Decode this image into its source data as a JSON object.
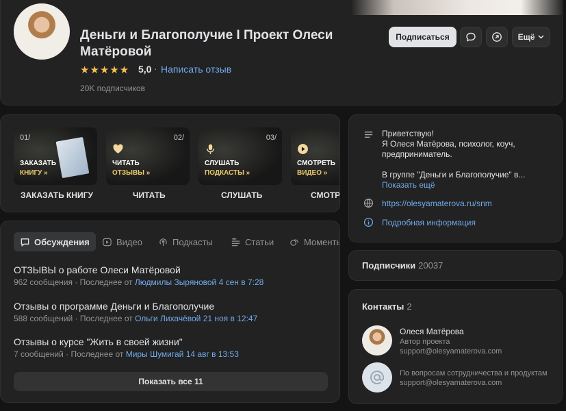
{
  "header": {
    "title": "Деньги и Благополучие I Проект Олеси Матёровой",
    "stars": "★★★★★",
    "rating": "5,0",
    "separator": "·",
    "write_review": "Написать отзыв",
    "subscribers": "20K подписчиков",
    "subscribe": "Подписаться",
    "more": "Ещё"
  },
  "tiles": [
    {
      "num": "01/",
      "line1": "ЗАКАЗАТЬ",
      "line2": "КНИГУ »",
      "label": "ЗАКАЗАТЬ КНИГУ"
    },
    {
      "num": "02/",
      "line1": "ЧИТАТЬ",
      "line2": "ОТЗЫВЫ »",
      "label": "ЧИТАТЬ"
    },
    {
      "num": "03/",
      "line1": "СЛУШАТЬ",
      "line2": "ПОДКАСТЫ »",
      "label": "СЛУШАТЬ"
    },
    {
      "num": "",
      "line1": "СМОТРЕТЬ",
      "line2": "ВИДЕО »",
      "label": "СМОТРЕТЬ"
    }
  ],
  "tabs": [
    "Обсуждения",
    "Видео",
    "Подкасты",
    "Статьи",
    "Моменты"
  ],
  "topics": [
    {
      "title": "ОТЗЫВЫ о работе Олеси Матёровой",
      "count": "962 сообщения · Последнее от ",
      "author": "Людмилы Зыряновой 4 сен в 7:28"
    },
    {
      "title": "Отзывы о программе Деньги и Благополучие",
      "count": "588 сообщений · Последнее от ",
      "author": "Ольги Лихачёвой 21 ноя в 12:47"
    },
    {
      "title": "Отзывы о курсе \"Жить в своей жизни\"",
      "count": "7 сообщений · Последнее от ",
      "author": "Миры Шумигай 14 авг в 13:53"
    }
  ],
  "show_all": "Показать все 11",
  "about": {
    "line1": "Приветствую!",
    "line2": "Я Олеся Матёрова, психолог, коуч,",
    "line3": "предприниматель.",
    "line4": "В группе \"Деньги и Благополучие\" в...",
    "show_more": "Показать ещё",
    "url": "https://olesyamaterova.ru/snm",
    "details": "Подробная информация"
  },
  "followers": {
    "label": "Подписчики",
    "count": "20037"
  },
  "contacts": {
    "label": "Контакты",
    "count": "2",
    "items": [
      {
        "name": "Олеся Матёрова",
        "role": "Автор проекта",
        "email": "support@olesyamaterova.com"
      },
      {
        "name": "",
        "role": "По вопросам сотрудничества и продуктам",
        "email": "support@olesyamaterova.com"
      }
    ]
  },
  "colors": {
    "accent_link": "#71aaeb",
    "star": "#f5bf4f",
    "background": "#141414",
    "card": "#222222"
  }
}
